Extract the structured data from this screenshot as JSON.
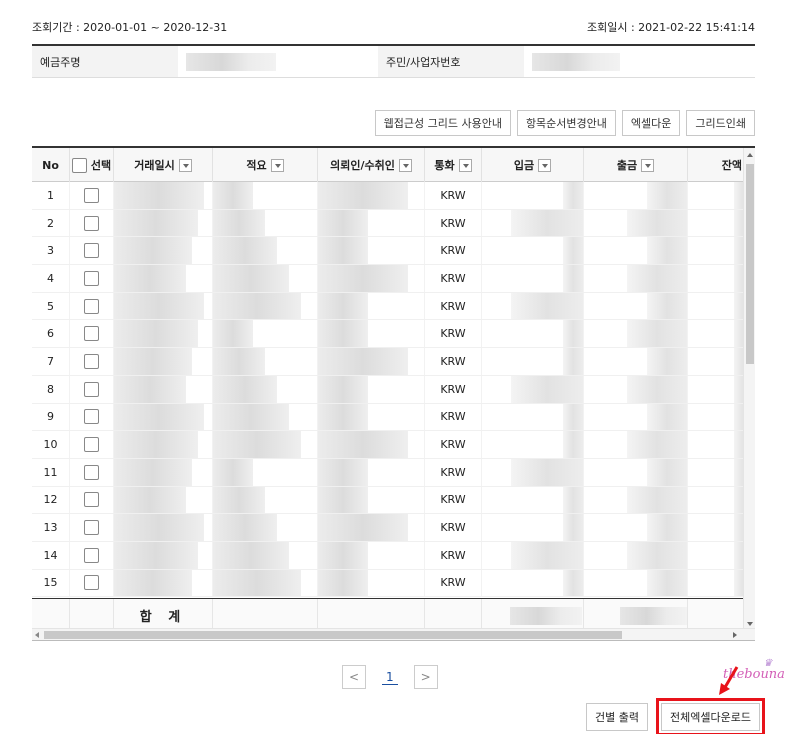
{
  "top": {
    "period": "조회기간 : 2020-01-01 ~ 2020-12-31",
    "inquiry_time": "조회일시 : 2021-02-22 15:41:14"
  },
  "account": {
    "holder_label": "예금주명",
    "id_label": "주민/사업자번호"
  },
  "toolbar": {
    "buttons": [
      "웹접근성 그리드 사용안내",
      "항목순서변경안내",
      "엑셀다운",
      "그리드인쇄"
    ]
  },
  "grid": {
    "columns": [
      "No",
      "선택",
      "거래일시",
      "적요",
      "의뢰인/수취인",
      "통화",
      "입금",
      "출금",
      "잔액"
    ],
    "rows": [
      {
        "no": "1",
        "currency": "KRW"
      },
      {
        "no": "2",
        "currency": "KRW"
      },
      {
        "no": "3",
        "currency": "KRW"
      },
      {
        "no": "4",
        "currency": "KRW"
      },
      {
        "no": "5",
        "currency": "KRW"
      },
      {
        "no": "6",
        "currency": "KRW"
      },
      {
        "no": "7",
        "currency": "KRW"
      },
      {
        "no": "8",
        "currency": "KRW"
      },
      {
        "no": "9",
        "currency": "KRW"
      },
      {
        "no": "10",
        "currency": "KRW"
      },
      {
        "no": "11",
        "currency": "KRW"
      },
      {
        "no": "12",
        "currency": "KRW"
      },
      {
        "no": "13",
        "currency": "KRW"
      },
      {
        "no": "14",
        "currency": "KRW"
      },
      {
        "no": "15",
        "currency": "KRW"
      }
    ],
    "sum_label": "합 계"
  },
  "pagination": {
    "prev": "<",
    "current": "1",
    "next": ">"
  },
  "actions": {
    "print_each": "건별 출력",
    "download_all_excel": "전체엑셀다운로드"
  },
  "watermark": {
    "text": "thebouna"
  },
  "colors": {
    "highlight": "#e8131a",
    "link": "#1a4fa0"
  }
}
